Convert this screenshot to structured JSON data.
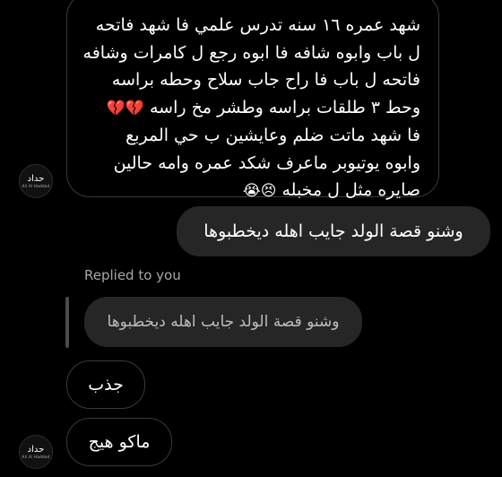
{
  "thread": {
    "incoming_long": {
      "lines": [
        "شهد عمره ١٦ سنه تدرس علمي فا شهد فاتحه",
        "ل باب وابوه شافه فا ابوه رجع ل كامرات وشافه",
        "فاتحه ل باب فا راح جاب سلاح وحطه براسه",
        "وحط ٣ طلقات براسه وطشر مخ راسه",
        "فا شهد ماتت ضلم وعايشين ب حي المربع",
        "وابوه يوتيوبر ماعرف شكد عمره وامه حالين",
        "صايره مثل ل مخبله"
      ],
      "emoji_line4": "💔💔",
      "emoji_line7": "😣😭"
    },
    "sender_avatar": {
      "name": "حداد",
      "sub": "Ali Al Haddad"
    },
    "outgoing": {
      "text": "وشنو قصة الولد جايب اهله ديخطبوها"
    },
    "reply": {
      "label": "Replied to you",
      "quoted_text": "وشنو قصة الولد جايب اهله ديخطبوها"
    },
    "incoming_short_1": "جذب",
    "incoming_short_2": "ماكو هيج"
  }
}
